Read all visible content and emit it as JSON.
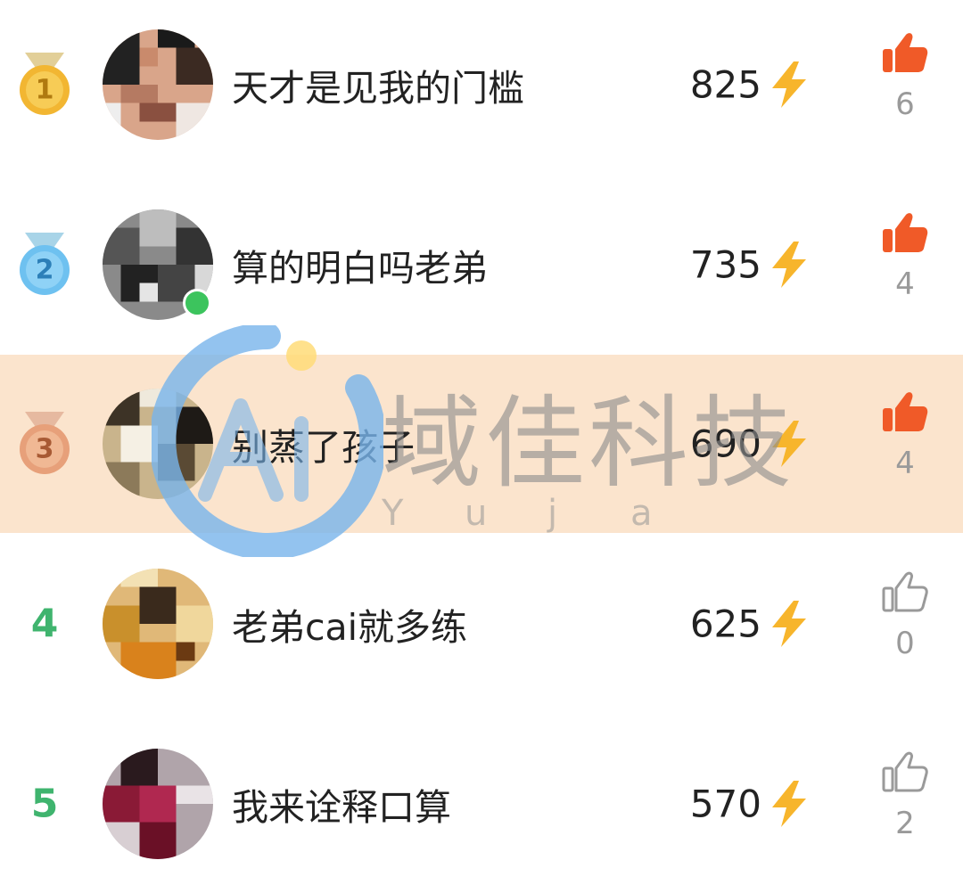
{
  "leaderboard": [
    {
      "rank": "1",
      "name": "天才是见我的门槛",
      "score": "825",
      "likes": "6",
      "liked": true,
      "medal_color": "#f2b632",
      "medal_ribbon": "#d9c89a"
    },
    {
      "rank": "2",
      "name": "算的明白吗老弟",
      "score": "735",
      "likes": "4",
      "liked": true,
      "medal_color": "#6ec1f0",
      "medal_ribbon": "#9fd0e8"
    },
    {
      "rank": "3",
      "name": "别蒸了孩子",
      "score": "690",
      "likes": "4",
      "liked": true,
      "medal_color": "#e7a07a",
      "medal_ribbon": "#e6b9a0"
    },
    {
      "rank": "4",
      "name": "老弟cai就多练",
      "score": "625",
      "likes": "0",
      "liked": false
    },
    {
      "rank": "5",
      "name": "我来诠释口算",
      "score": "570",
      "likes": "2",
      "liked": false
    }
  ],
  "watermark": {
    "text": "域佳科技",
    "sub": [
      "Y",
      "u",
      "j",
      "a"
    ]
  },
  "colors": {
    "highlight_row": "#fbe4cd",
    "bolt": "#f7b52c",
    "thumb_active": "#f05a28",
    "thumb_inactive": "#9a9a9a",
    "rank_text": "#3fb46e"
  },
  "icons": {
    "score": "lightning-bolt-icon",
    "like": "thumbs-up-icon"
  }
}
